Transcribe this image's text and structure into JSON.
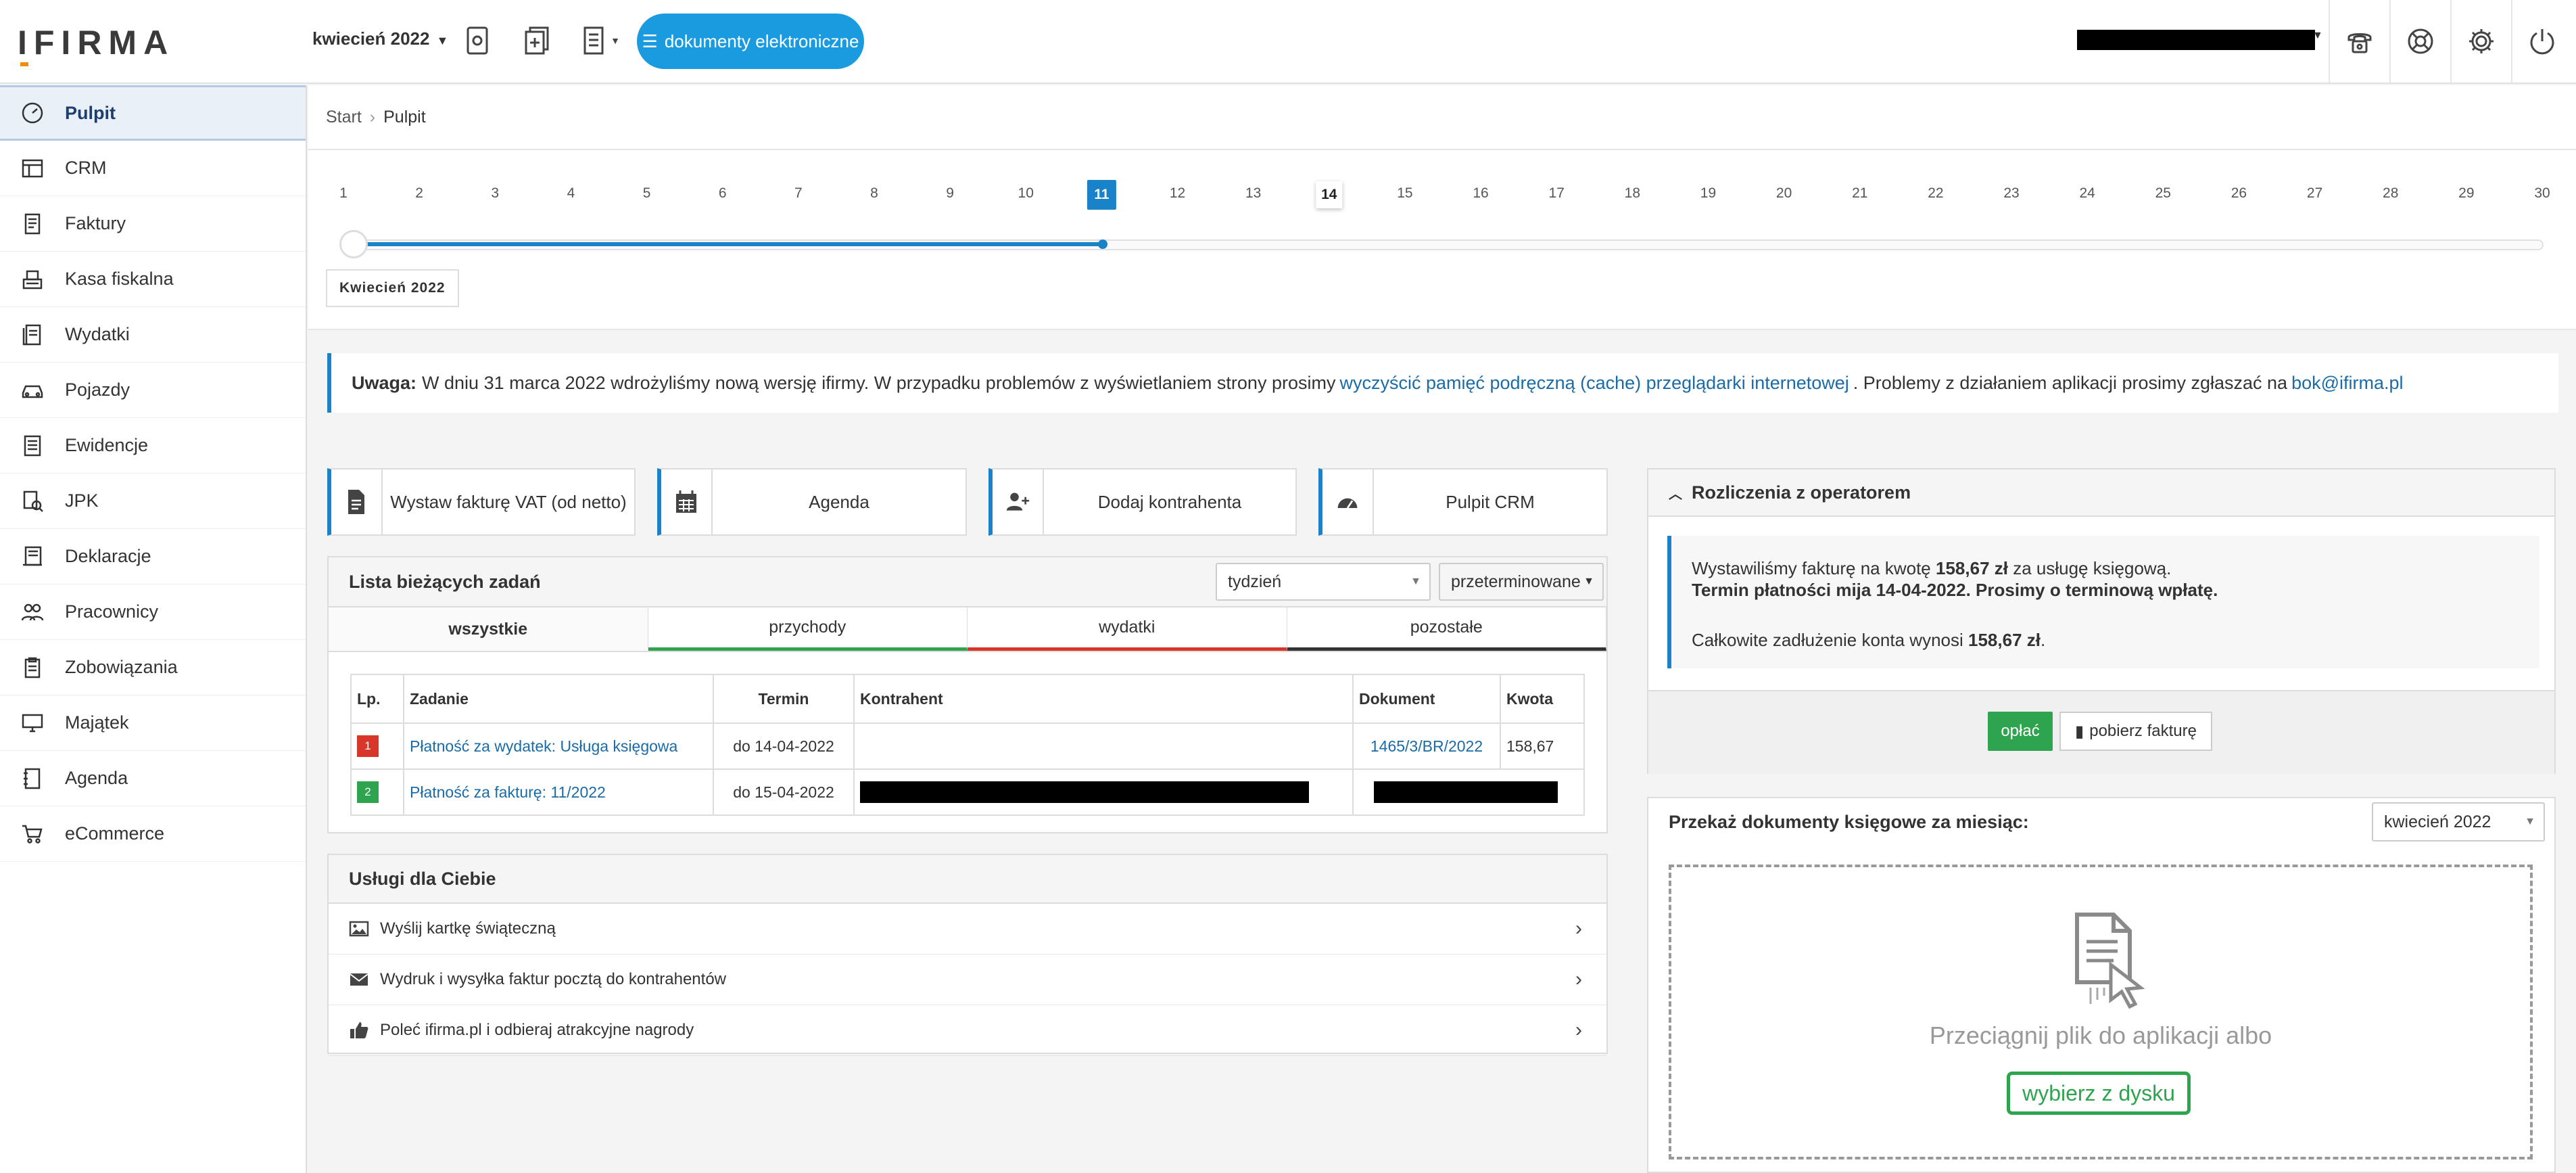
{
  "app": {
    "logo": "IFIRMA"
  },
  "topbar": {
    "month": "kwiecień 2022",
    "documents_button": "dokumenty elektroniczne"
  },
  "sidebar": {
    "items": [
      {
        "label": "Pulpit",
        "icon": "dashboard-icon",
        "active": true
      },
      {
        "label": "CRM",
        "icon": "crm-icon"
      },
      {
        "label": "Faktury",
        "icon": "invoice-icon"
      },
      {
        "label": "Kasa fiskalna",
        "icon": "cash-register-icon"
      },
      {
        "label": "Wydatki",
        "icon": "expenses-icon"
      },
      {
        "label": "Pojazdy",
        "icon": "car-icon"
      },
      {
        "label": "Ewidencje",
        "icon": "records-icon"
      },
      {
        "label": "JPK",
        "icon": "jpk-icon"
      },
      {
        "label": "Deklaracje",
        "icon": "declarations-icon"
      },
      {
        "label": "Pracownicy",
        "icon": "employees-icon"
      },
      {
        "label": "Zobowiązania",
        "icon": "liabilities-icon"
      },
      {
        "label": "Majątek",
        "icon": "assets-icon"
      },
      {
        "label": "Agenda",
        "icon": "agenda-icon"
      },
      {
        "label": "eCommerce",
        "icon": "cart-icon"
      }
    ]
  },
  "breadcrumb": {
    "root": "Start",
    "current": "Pulpit"
  },
  "timeline": {
    "days": [
      "1",
      "2",
      "3",
      "4",
      "5",
      "6",
      "7",
      "8",
      "9",
      "10",
      "11",
      "12",
      "13",
      "14",
      "15",
      "16",
      "17",
      "18",
      "19",
      "20",
      "21",
      "22",
      "23",
      "24",
      "25",
      "26",
      "27",
      "28",
      "29",
      "30"
    ],
    "today": "11",
    "deadline": "14",
    "label": "Kwiecień 2022"
  },
  "notice": {
    "bold": "Uwaga:",
    "text1": "W dniu 31 marca 2022 wdrożyliśmy nową wersję ifirmy. W przypadku problemów z wyświetlaniem strony prosimy",
    "link1": "wyczyścić pamięć podręczną (cache) przeglądarki internetowej",
    "text2": ". Problemy z działaniem aplikacji prosimy zgłaszać na",
    "link2": "bok@ifirma.pl"
  },
  "quick_actions": [
    {
      "label": "Wystaw fakturę VAT (od netto)",
      "icon": "document-icon"
    },
    {
      "label": "Agenda",
      "icon": "calendar-icon"
    },
    {
      "label": "Dodaj kontrahenta",
      "icon": "add-user-icon"
    },
    {
      "label": "Pulpit CRM",
      "icon": "speedometer-icon"
    }
  ],
  "tasks": {
    "title": "Lista bieżących zadań",
    "period": "tydzień",
    "filter": "przeterminowane",
    "tabs": [
      "wszystkie",
      "przychody",
      "wydatki",
      "pozostałe"
    ],
    "columns": [
      "Lp.",
      "Zadanie",
      "Termin",
      "Kontrahent",
      "Dokument",
      "Kwota"
    ],
    "rows": [
      {
        "lp": "1",
        "task": "Płatność za wydatek: Usługa księgowa",
        "due": "do 14-04-2022",
        "doc": "1465/3/BR/2022",
        "amount": "158,67"
      },
      {
        "lp": "2",
        "task": "Płatność za fakturę: 11/2022",
        "due": "do 15-04-2022",
        "doc": "",
        "amount": ""
      }
    ]
  },
  "services": {
    "title": "Usługi dla Ciebie",
    "items": [
      {
        "label": "Wyślij kartkę świąteczną",
        "icon": "image-icon"
      },
      {
        "label": "Wydruk i wysyłka faktur pocztą do kontrahentów",
        "icon": "envelope-icon"
      },
      {
        "label": "Poleć ifirma.pl i odbieraj atrakcyjne nagrody",
        "icon": "thumbs-up-icon"
      }
    ]
  },
  "settlements": {
    "title": "Rozliczenia z operatorem",
    "line1_a": "Wystawiliśmy fakturę na kwotę",
    "line1_amount": "158,67 zł",
    "line1_b": "za usługę księgową.",
    "line2": "Termin płatności mija 14-04-2022. Prosimy o terminową wpłatę.",
    "line3_a": "Całkowite zadłużenie konta wynosi",
    "line3_amount": "158,67 zł",
    "line3_b": ".",
    "pay_button": "opłać",
    "download_button": "pobierz fakturę"
  },
  "upload": {
    "title": "Przekaż dokumenty księgowe za miesiąc:",
    "month": "kwiecień 2022",
    "drop_text": "Przeciągnij plik do aplikacji albo",
    "pick_button": "wybierz z dysku"
  },
  "colors": {
    "accent": "#1a82c8",
    "button_blue": "#1a9be0",
    "green": "#2ea44f",
    "red": "#d9362b"
  }
}
